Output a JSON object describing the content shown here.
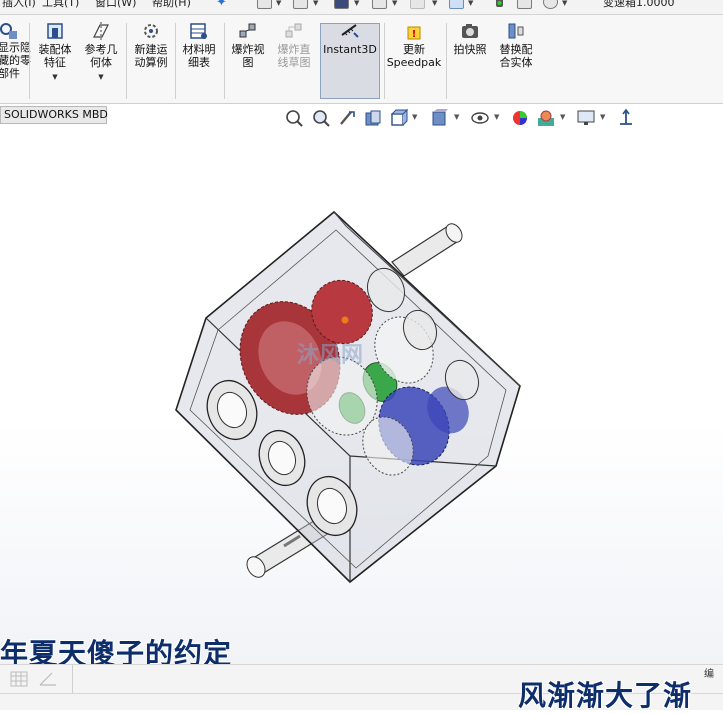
{
  "menubar": {
    "items": [
      "插入(I)",
      "工具(T)",
      "窗口(W)",
      "帮助(H)"
    ],
    "document_title": "变速箱1.0000"
  },
  "ribbon": {
    "buttons": [
      {
        "label": "显示隐\n藏的零\n部件",
        "icon": "show-hidden-components-icon",
        "enabled": true
      },
      {
        "label": "装配体\n特征",
        "icon": "assembly-features-icon",
        "enabled": true,
        "dropdown": true
      },
      {
        "label": "参考几\n何体",
        "icon": "reference-geometry-icon",
        "enabled": true,
        "dropdown": true
      },
      {
        "label": "新建运\n动算例",
        "icon": "new-motion-study-icon",
        "enabled": true
      },
      {
        "label": "材料明\n细表",
        "icon": "bill-of-materials-icon",
        "enabled": true
      },
      {
        "label": "爆炸视\n图",
        "icon": "exploded-view-icon",
        "enabled": true
      },
      {
        "label": "爆炸直\n线草图",
        "icon": "explode-line-sketch-icon",
        "enabled": false
      },
      {
        "label": "Instant3D",
        "icon": "instant3d-icon",
        "enabled": true,
        "active": true
      },
      {
        "label": "更新\nSpeedpak",
        "icon": "update-speedpak-icon",
        "enabled": true
      },
      {
        "label": "拍快照",
        "icon": "take-snapshot-icon",
        "enabled": true
      },
      {
        "label": "替换配\n合实体",
        "icon": "replace-mate-entities-icon",
        "enabled": true
      }
    ]
  },
  "tabs": {
    "active": "SOLIDWORKS MBD"
  },
  "view_toolbar": {
    "icons": [
      "zoom-to-fit-icon",
      "zoom-to-area-icon",
      "previous-view-icon",
      "section-view-icon",
      "view-orientation-icon",
      "display-style-icon",
      "hide-show-items-icon",
      "edit-appearance-icon",
      "apply-scene-icon",
      "view-settings-icon",
      "triad-icon"
    ]
  },
  "model": {
    "watermark": "沐风网",
    "colors": {
      "red_gear": "#a8353a",
      "green_gear": "#3aa84a",
      "blue_gear": "#3b46b8",
      "housing": "#b9bdc9",
      "origin_point": "#f07a1a"
    }
  },
  "overlay": {
    "subtitle_line1": "年夏天傻子的约定",
    "subtitle_line2": "风渐渐大了渐"
  },
  "statusbar": {
    "icons": [
      "grid-icon",
      "angle-icon"
    ],
    "right_text": "编"
  }
}
